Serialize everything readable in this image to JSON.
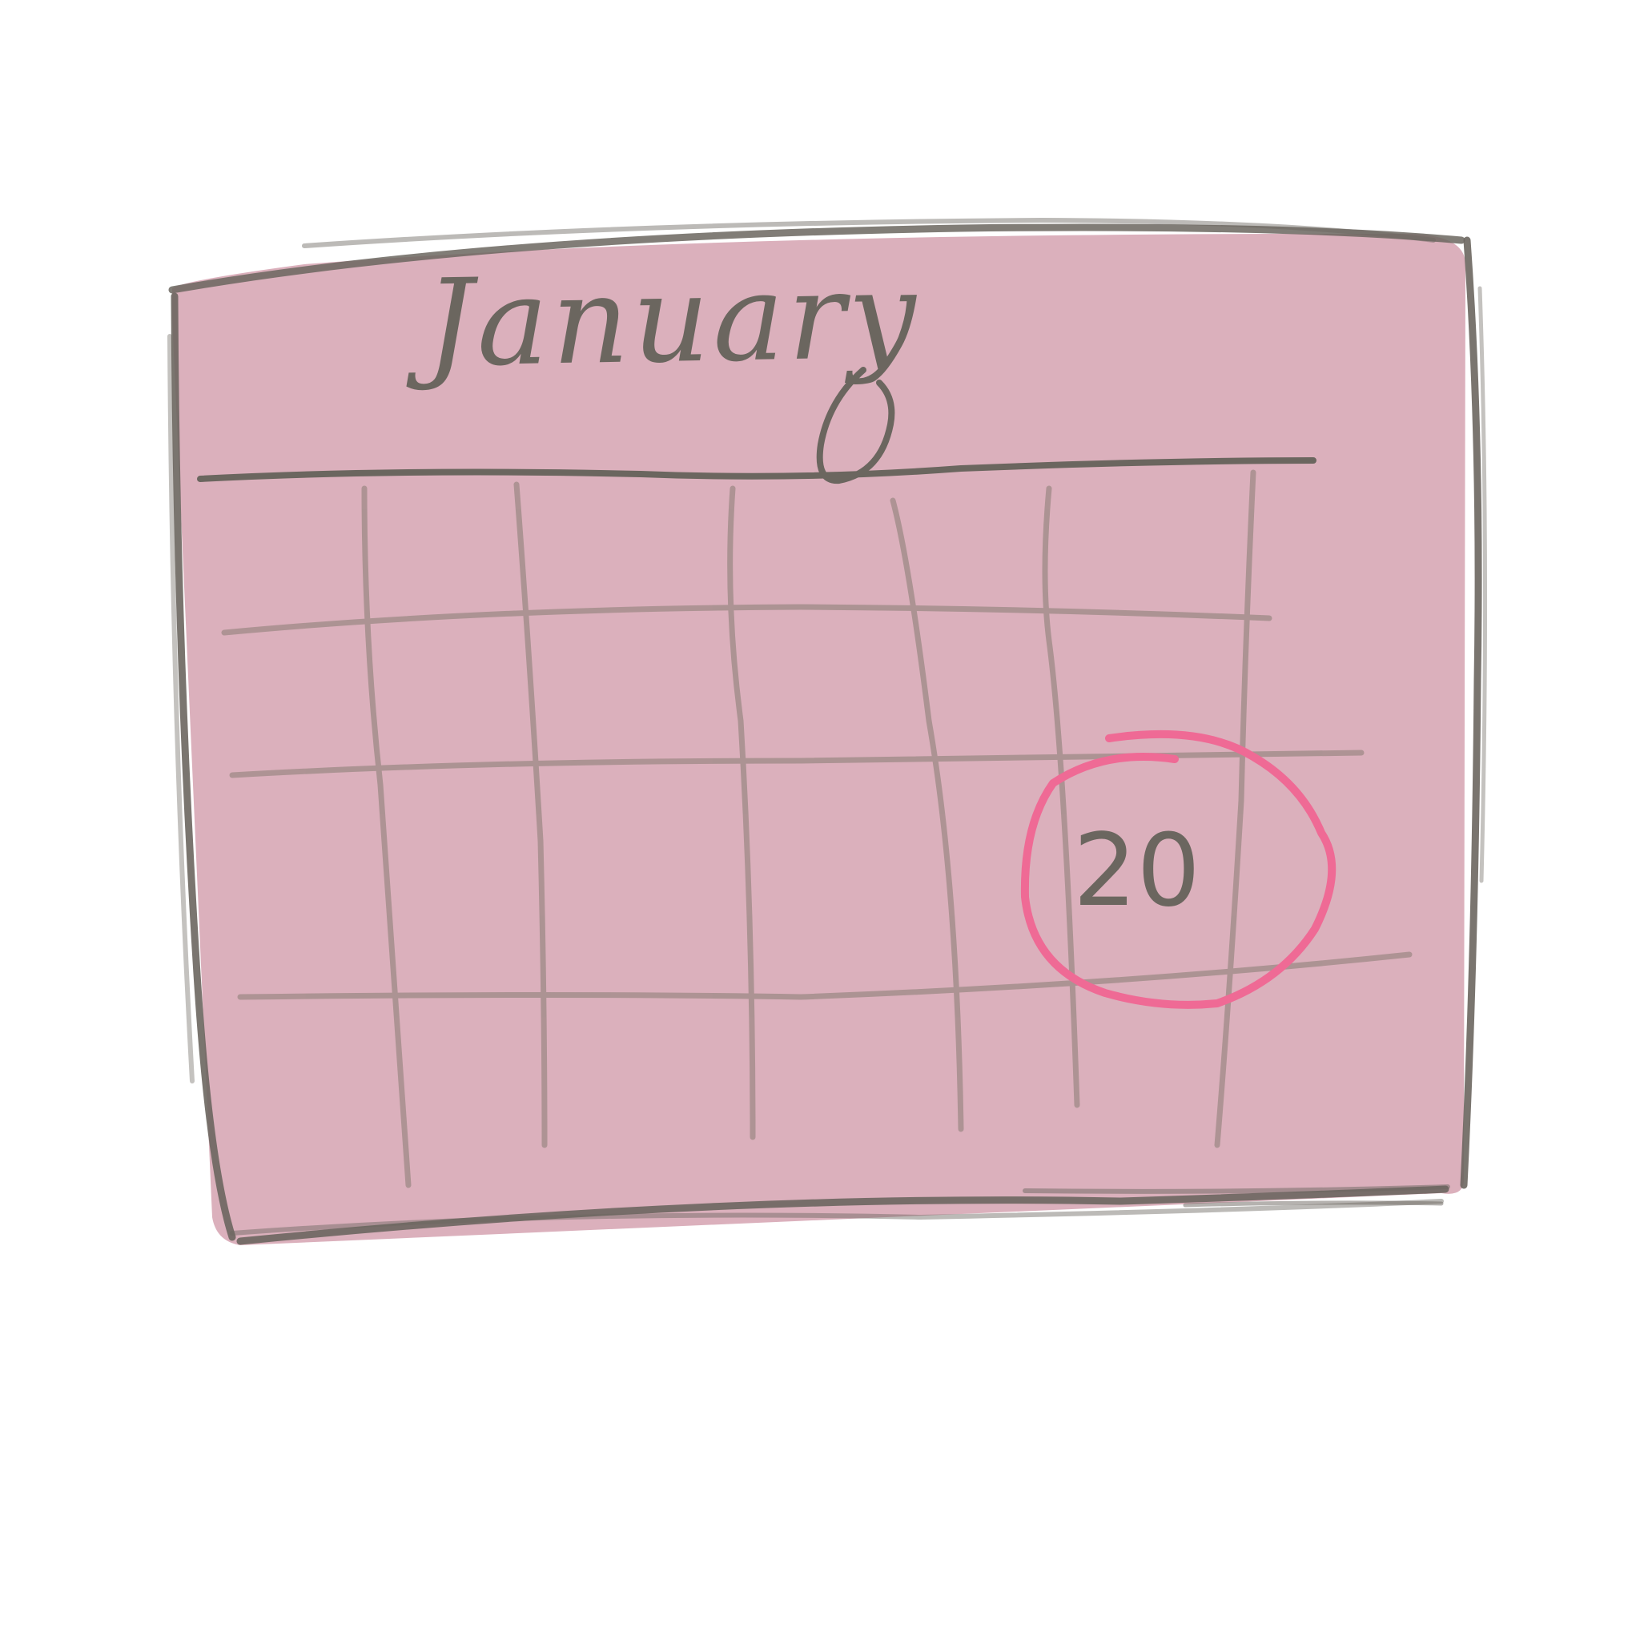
{
  "calendar": {
    "month": "January",
    "highlighted_day": "20"
  },
  "colors": {
    "page_fill": "#dbb0bc",
    "outline": "#6b665f",
    "grid_line": "#a8908f",
    "highlight_ring": "#ef6a95",
    "background": "#ffffff"
  }
}
